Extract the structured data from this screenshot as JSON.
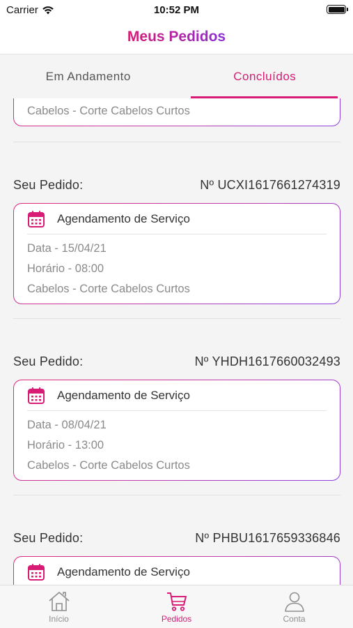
{
  "status_bar": {
    "carrier": "Carrier",
    "time": "10:52 PM",
    "wifi_icon": "wifi-icon",
    "battery_level": 1.0
  },
  "header": {
    "title": "Meus Pedidos"
  },
  "tabs": [
    {
      "label": "Em Andamento",
      "active": false
    },
    {
      "label": "Concluídos",
      "active": true
    }
  ],
  "partial_card": {
    "line": "Cabelos - Corte Cabelos Curtos"
  },
  "orders": [
    {
      "label": "Seu Pedido:",
      "number": "Nº UCXI1617661274319",
      "card_title": "Agendamento de Serviço",
      "date": "Data - 15/04/21",
      "time": "Horário - 08:00",
      "service": "Cabelos - Corte Cabelos Curtos"
    },
    {
      "label": "Seu Pedido:",
      "number": "Nº YHDH1617660032493",
      "card_title": "Agendamento de Serviço",
      "date": "Data - 08/04/21",
      "time": "Horário - 13:00",
      "service": "Cabelos - Corte Cabelos Curtos"
    },
    {
      "label": "Seu Pedido:",
      "number": "Nº PHBU1617659336846",
      "card_title": "Agendamento de Serviço",
      "date": "",
      "time": "",
      "service": ""
    }
  ],
  "tabbar": [
    {
      "label": "Início",
      "icon": "home-icon",
      "active": false
    },
    {
      "label": "Pedidos",
      "icon": "cart-icon",
      "active": true
    },
    {
      "label": "Conta",
      "icon": "user-icon",
      "active": false
    }
  ],
  "colors": {
    "accent": "#d81b74",
    "accent_purple": "#8a3ee0",
    "background": "#f4f4f4"
  }
}
